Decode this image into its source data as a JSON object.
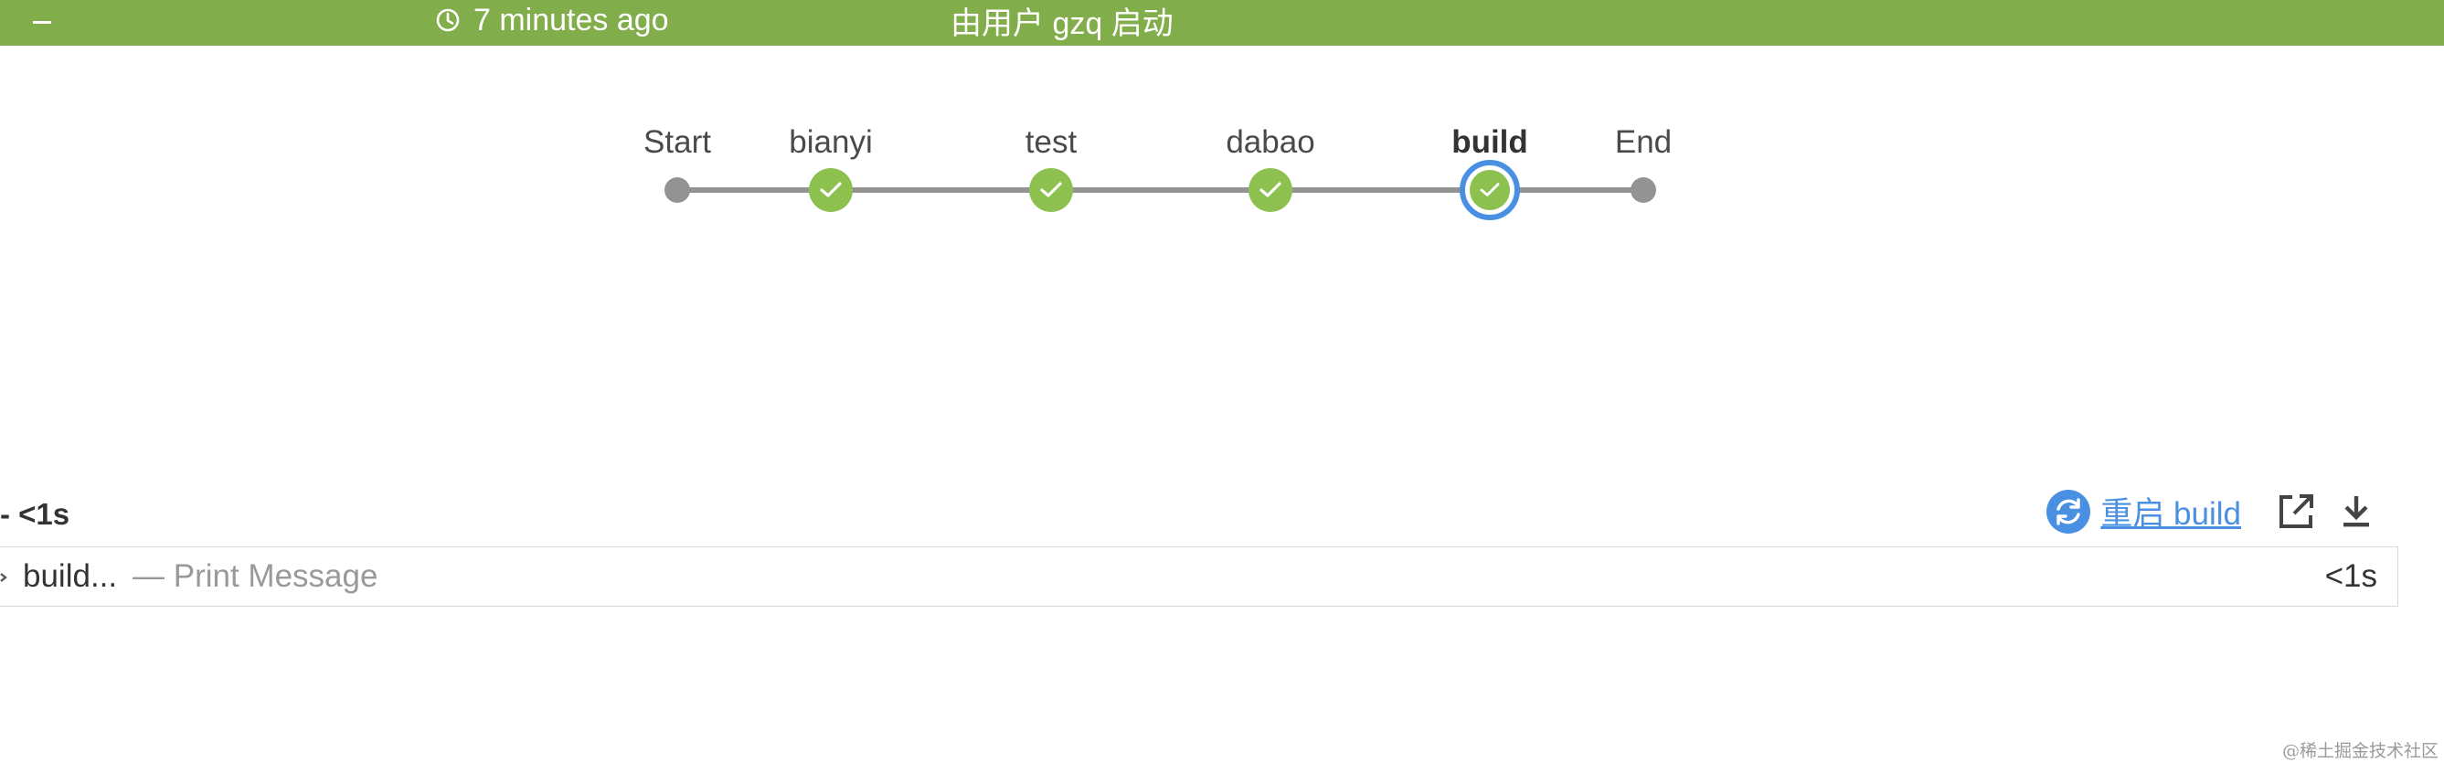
{
  "header": {
    "collapse_icon": "minus-icon",
    "time_icon": "clock-icon",
    "time_text": "7 minutes ago",
    "started_by_text": "由用户 gzq 启动",
    "background_color": "#82ad4b"
  },
  "pipeline": {
    "stages": [
      {
        "label": "Start",
        "status": "terminal"
      },
      {
        "label": "bianyi",
        "status": "success"
      },
      {
        "label": "test",
        "status": "success"
      },
      {
        "label": "dabao",
        "status": "success"
      },
      {
        "label": "build",
        "status": "success",
        "selected": true
      },
      {
        "label": "End",
        "status": "terminal"
      }
    ],
    "success_color": "#8cc04f",
    "selected_ring_color": "#4a90e2",
    "connector_color": "#949393"
  },
  "step": {
    "duration_text": "- <1s",
    "restart_icon": "refresh-icon",
    "restart_label": "重启 build",
    "open_icon": "external-link-icon",
    "download_icon": "download-icon"
  },
  "log": {
    "expand_icon": "chevron-right-icon",
    "name": "build...",
    "description": "— Print Message",
    "duration": "<1s"
  },
  "watermark": "@稀土掘金技术社区"
}
